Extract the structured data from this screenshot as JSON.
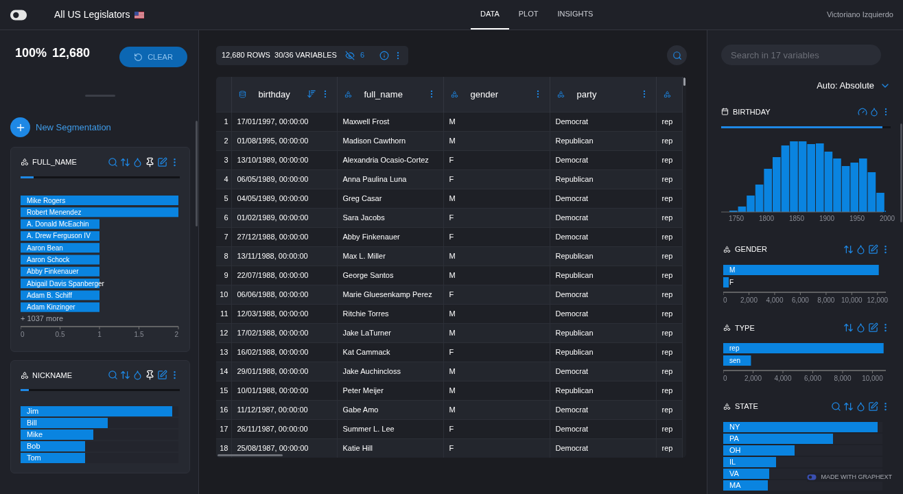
{
  "header": {
    "title": "All US Legislators",
    "user": "Victoriano Izquierdo"
  },
  "tabs": [
    {
      "label": "DATA",
      "selected": true
    },
    {
      "label": "PLOT",
      "selected": false
    },
    {
      "label": "INSIGHTS",
      "selected": false
    }
  ],
  "left_panel": {
    "percent": "100%",
    "count": "12,680",
    "clear_button": "CLEAR",
    "new_segmentation": "New Segmentation",
    "cards": [
      {
        "title": "FULL_NAME",
        "searchable": true,
        "pinnable": true,
        "level": 0.08,
        "more": "+ 1037 more",
        "chart_data": {
          "type": "bar",
          "orientation": "horizontal",
          "categories": [
            "Mike Rogers",
            "Robert Menendez",
            "A. Donald McEachin",
            "A. Drew Ferguson IV",
            "Aaron Bean",
            "Aaron Schock",
            "Abby Finkenauer",
            "Abigail Davis Spanberger",
            "Adam B. Schiff",
            "Adam Kinzinger"
          ],
          "values": [
            2,
            2,
            1,
            1,
            1,
            1,
            1,
            1,
            1,
            1
          ],
          "xlim": [
            0,
            2
          ],
          "xticks": [
            {
              "value": 0,
              "label": "0"
            },
            {
              "value": 0.5,
              "label": "0.5"
            },
            {
              "value": 1,
              "label": "1"
            },
            {
              "value": 1.5,
              "label": "1.5"
            },
            {
              "value": 2,
              "label": "2"
            }
          ]
        }
      },
      {
        "title": "NICKNAME",
        "searchable": true,
        "pinnable": true,
        "level": 0.05,
        "bars": [
          {
            "label": "Jim",
            "level": 0.96
          },
          {
            "label": "Bill",
            "level": 0.55
          },
          {
            "label": "Mike",
            "level": 0.46
          },
          {
            "label": "Bob",
            "level": 0.41
          },
          {
            "label": "Tom",
            "level": 0.41
          }
        ]
      }
    ]
  },
  "table": {
    "summary": "12,680 ROWS  30/36 VARIABLES",
    "hidden_count": "6",
    "columns": [
      {
        "label": "birthday",
        "sorted": true
      },
      {
        "label": "full_name",
        "sorted": false
      },
      {
        "label": "gender",
        "sorted": false
      },
      {
        "label": "party",
        "sorted": false
      },
      {}
    ],
    "rows": [
      {
        "number": "1",
        "cells": [
          "17/01/1997, 00:00:00",
          "Maxwell Frost",
          "M",
          "Democrat",
          "rep"
        ]
      },
      {
        "number": "2",
        "cells": [
          "01/08/1995, 00:00:00",
          "Madison Cawthorn",
          "M",
          "Republican",
          "rep"
        ]
      },
      {
        "number": "3",
        "cells": [
          "13/10/1989, 00:00:00",
          "Alexandria Ocasio-Cortez",
          "F",
          "Democrat",
          "rep"
        ]
      },
      {
        "number": "4",
        "cells": [
          "06/05/1989, 00:00:00",
          "Anna Paulina Luna",
          "F",
          "Republican",
          "rep"
        ]
      },
      {
        "number": "5",
        "cells": [
          "04/05/1989, 00:00:00",
          "Greg Casar",
          "M",
          "Democrat",
          "rep"
        ]
      },
      {
        "number": "6",
        "cells": [
          "01/02/1989, 00:00:00",
          "Sara Jacobs",
          "F",
          "Democrat",
          "rep"
        ]
      },
      {
        "number": "7",
        "cells": [
          "27/12/1988, 00:00:00",
          "Abby Finkenauer",
          "F",
          "Democrat",
          "rep"
        ]
      },
      {
        "number": "8",
        "cells": [
          "13/11/1988, 00:00:00",
          "Max L. Miller",
          "M",
          "Republican",
          "rep"
        ]
      },
      {
        "number": "9",
        "cells": [
          "22/07/1988, 00:00:00",
          "George Santos",
          "M",
          "Republican",
          "rep"
        ]
      },
      {
        "number": "10",
        "cells": [
          "06/06/1988, 00:00:00",
          "Marie Gluesenkamp Perez",
          "F",
          "Democrat",
          "rep"
        ]
      },
      {
        "number": "11",
        "cells": [
          "12/03/1988, 00:00:00",
          "Ritchie Torres",
          "M",
          "Democrat",
          "rep"
        ]
      },
      {
        "number": "12",
        "cells": [
          "17/02/1988, 00:00:00",
          "Jake LaTurner",
          "M",
          "Republican",
          "rep"
        ]
      },
      {
        "number": "13",
        "cells": [
          "16/02/1988, 00:00:00",
          "Kat Cammack",
          "F",
          "Republican",
          "rep"
        ]
      },
      {
        "number": "14",
        "cells": [
          "29/01/1988, 00:00:00",
          "Jake Auchincloss",
          "M",
          "Democrat",
          "rep"
        ]
      },
      {
        "number": "15",
        "cells": [
          "10/01/1988, 00:00:00",
          "Peter Meijer",
          "M",
          "Republican",
          "rep"
        ]
      },
      {
        "number": "16",
        "cells": [
          "11/12/1987, 00:00:00",
          "Gabe Amo",
          "M",
          "Democrat",
          "rep"
        ]
      },
      {
        "number": "17",
        "cells": [
          "26/11/1987, 00:00:00",
          "Summer L. Lee",
          "F",
          "Democrat",
          "rep"
        ]
      },
      {
        "number": "18",
        "cells": [
          "25/08/1987, 00:00:00",
          "Katie Hill",
          "F",
          "Democrat",
          "rep"
        ]
      }
    ]
  },
  "right_panel": {
    "search": {
      "placeholder": "Search in 17 variables"
    },
    "scale": "Auto: Absolute",
    "birthday": {
      "title": "BIRTHDAY",
      "level": 0.95,
      "x_ticks": [
        "1750",
        "1800",
        "1850",
        "1900",
        "1950",
        "2000"
      ]
    },
    "cards": [
      {
        "title": "GENDER",
        "searchable": false,
        "chart_data": {
          "type": "bar",
          "orientation": "horizontal",
          "categories": [
            "M",
            "F"
          ],
          "values": [
            12100,
            430
          ],
          "xlim": [
            0,
            12650
          ],
          "xticks": [
            {
              "value": 0,
              "label": "0"
            },
            {
              "value": 2000,
              "label": "2,000"
            },
            {
              "value": 4000,
              "label": "4,000"
            },
            {
              "value": 6000,
              "label": "6,000"
            },
            {
              "value": 8000,
              "label": "8,000"
            },
            {
              "value": 10000,
              "label": "10,000"
            },
            {
              "value": 12000,
              "label": "12,000"
            }
          ]
        }
      },
      {
        "title": "TYPE",
        "searchable": false,
        "chart_data": {
          "type": "bar",
          "orientation": "horizontal",
          "categories": [
            "rep",
            "sen"
          ],
          "values": [
            10750,
            1860
          ],
          "xlim": [
            0,
            10900
          ],
          "xticks": [
            {
              "value": 0,
              "label": "0"
            },
            {
              "value": 2000,
              "label": "2,000"
            },
            {
              "value": 4000,
              "label": "4,000"
            },
            {
              "value": 6000,
              "label": "6,000"
            },
            {
              "value": 8000,
              "label": "8,000"
            },
            {
              "value": 10000,
              "label": "10,000"
            }
          ]
        }
      },
      {
        "title": "STATE",
        "searchable": true,
        "bars": [
          {
            "label": "NY",
            "level": 0.97
          },
          {
            "label": "PA",
            "level": 0.69
          },
          {
            "label": "OH",
            "level": 0.45
          },
          {
            "label": "IL",
            "level": 0.33
          },
          {
            "label": "VA",
            "level": 0.29
          },
          {
            "label": "MA",
            "level": 0.28
          }
        ]
      }
    ]
  },
  "badge": "MADE WITH GRAPHEXT"
}
